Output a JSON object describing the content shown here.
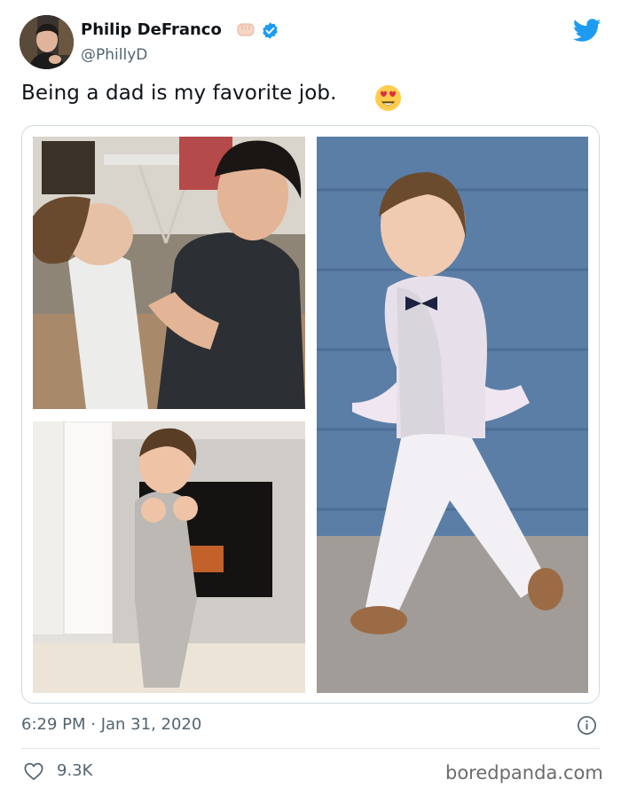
{
  "author": {
    "display_name": "Philip DeFranco",
    "handle": "@PhillyD",
    "verified": true
  },
  "tweet": {
    "text": "Being a dad is my favorite job.",
    "emoji": "smiling-face-heart-eyes",
    "timestamp": "6:29 PM · Jan 31, 2020",
    "likes": "9.3K"
  },
  "media": {
    "count": 3
  },
  "watermark": "boredpanda.com",
  "colors": {
    "twitter_blue": "#1d9bf0",
    "text_primary": "#0f1419",
    "text_secondary": "#536471",
    "border": "#cfd9de"
  }
}
